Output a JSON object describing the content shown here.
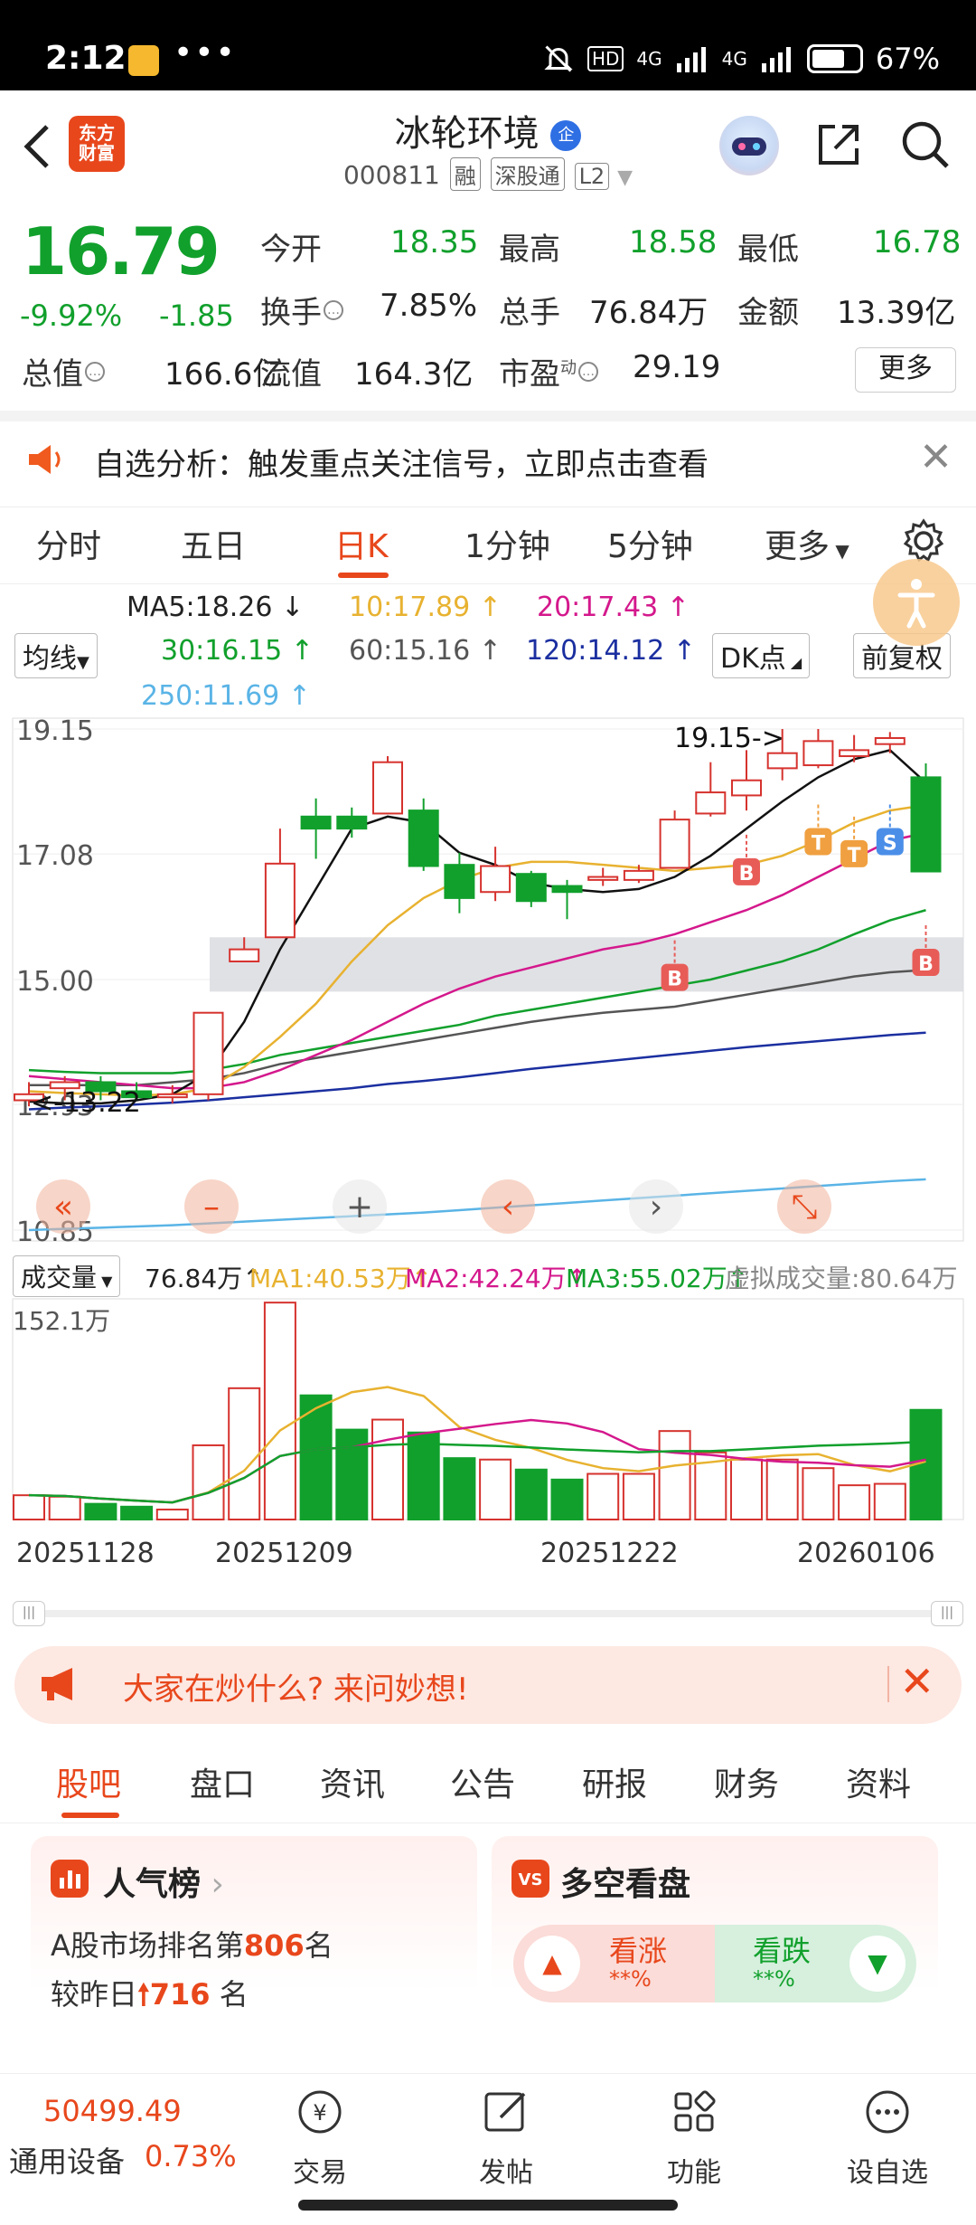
{
  "status_bar": {
    "time": "2:12",
    "dots": "•••",
    "hd": "HD",
    "net1": "4G",
    "net2": "4G",
    "battery": "67%"
  },
  "header": {
    "logo_line1": "东方",
    "logo_line2": "财富",
    "stock_name": "冰轮环境",
    "qi_badge": "企",
    "stock_code": "000811",
    "tags": [
      "融",
      "深股通",
      "L2"
    ]
  },
  "quote": {
    "price": "16.79",
    "change_pct": "-9.92%",
    "change": "-1.85",
    "open_label": "今开",
    "open": "18.35",
    "high_label": "最高",
    "high": "18.58",
    "low_label": "最低",
    "low": "16.78",
    "turnover_label": "换手",
    "turnover": "7.85%",
    "volume_label": "总手",
    "volume": "76.84万",
    "amount_label": "金额",
    "amount": "13.39亿",
    "mcap_label": "总值",
    "mcap": "166.6亿",
    "float_label": "流值",
    "float": "164.3亿",
    "pe_label": "市盈",
    "pe_sup": "动",
    "pe": "29.19",
    "more_label": "更多"
  },
  "alert": {
    "text": "自选分析：触发重点关注信号，立即点击查看"
  },
  "tabs": [
    "分时",
    "五日",
    "日K",
    "1分钟",
    "5分钟",
    "更多"
  ],
  "active_tab": "日K",
  "ma": {
    "selector": "均线",
    "ma5": "MA5:18.26",
    "ma10": "10:17.89",
    "ma20": "20:17.43",
    "ma30": "30:16.15",
    "ma60": "60:15.16",
    "ma120": "120:14.12",
    "ma250": "250:11.69",
    "dk_label": "DK点",
    "adjust_label": "前复权",
    "colors": {
      "ma5": "#111111",
      "ma10": "#e8b230",
      "ma20": "#d4188c",
      "ma30": "#11a02c",
      "ma60": "#555555",
      "ma120": "#1b2fa0",
      "ma250": "#5ab4e6"
    }
  },
  "chart_data": {
    "type": "candlestick",
    "y_ticks": [
      "19.15",
      "17.08",
      "15.00",
      "12.93",
      "10.85"
    ],
    "ylim": [
      10.85,
      19.15
    ],
    "annotations": {
      "high_marker": "19.15->",
      "low_marker": "<-13.22"
    },
    "signal_labels": [
      "B",
      "B",
      "T",
      "T",
      "S",
      "B"
    ],
    "candles": [
      {
        "o": 13.0,
        "c": 13.1,
        "h": 13.3,
        "l": 12.9
      },
      {
        "o": 13.2,
        "c": 13.3,
        "h": 13.4,
        "l": 13.0
      },
      {
        "o": 13.3,
        "c": 13.15,
        "h": 13.4,
        "l": 13.0
      },
      {
        "o": 13.15,
        "c": 13.05,
        "h": 13.3,
        "l": 13.0
      },
      {
        "o": 13.05,
        "c": 13.1,
        "h": 13.25,
        "l": 12.95
      },
      {
        "o": 13.1,
        "c": 14.45,
        "h": 14.45,
        "l": 13.0
      },
      {
        "o": 15.3,
        "c": 15.5,
        "h": 15.7,
        "l": 15.3
      },
      {
        "o": 15.7,
        "c": 16.92,
        "h": 17.5,
        "l": 15.7
      },
      {
        "o": 17.7,
        "c": 17.5,
        "h": 18.0,
        "l": 17.0
      },
      {
        "o": 17.7,
        "c": 17.5,
        "h": 17.85,
        "l": 17.35
      },
      {
        "o": 17.75,
        "c": 18.6,
        "h": 18.7,
        "l": 17.75
      },
      {
        "o": 17.8,
        "c": 16.88,
        "h": 18.0,
        "l": 16.8
      },
      {
        "o": 16.9,
        "c": 16.35,
        "h": 17.1,
        "l": 16.1
      },
      {
        "o": 16.45,
        "c": 16.88,
        "h": 17.2,
        "l": 16.3
      },
      {
        "o": 16.75,
        "c": 16.3,
        "h": 16.8,
        "l": 16.2
      },
      {
        "o": 16.55,
        "c": 16.45,
        "h": 16.65,
        "l": 16.0
      },
      {
        "o": 16.65,
        "c": 16.7,
        "h": 16.85,
        "l": 16.55
      },
      {
        "o": 16.65,
        "c": 16.8,
        "h": 16.9,
        "l": 16.6
      },
      {
        "o": 16.85,
        "c": 17.65,
        "h": 17.8,
        "l": 16.9
      },
      {
        "o": 17.75,
        "c": 18.1,
        "h": 18.6,
        "l": 17.7
      },
      {
        "o": 18.05,
        "c": 18.3,
        "h": 18.8,
        "l": 17.8
      },
      {
        "o": 18.5,
        "c": 18.75,
        "h": 19.15,
        "l": 18.3
      },
      {
        "o": 18.55,
        "c": 18.95,
        "h": 19.15,
        "l": 18.5
      },
      {
        "o": 18.7,
        "c": 18.8,
        "h": 19.05,
        "l": 18.6
      },
      {
        "o": 18.9,
        "c": 19.0,
        "h": 19.1,
        "l": 18.75
      },
      {
        "o": 18.35,
        "c": 16.79,
        "h": 18.58,
        "l": 16.78
      }
    ],
    "ma5": [
      12.98,
      12.95,
      12.95,
      13.0,
      13.1,
      13.45,
      14.3,
      15.5,
      16.5,
      17.5,
      17.7,
      17.6,
      17.1,
      16.9,
      16.6,
      16.5,
      16.45,
      16.5,
      16.7,
      17.05,
      17.5,
      17.95,
      18.35,
      18.65,
      18.8,
      18.26
    ],
    "ma10": [
      13.15,
      13.12,
      13.1,
      13.08,
      13.1,
      13.2,
      13.55,
      14.05,
      14.6,
      15.3,
      15.9,
      16.35,
      16.65,
      16.85,
      16.95,
      16.95,
      16.9,
      16.85,
      16.8,
      16.85,
      16.9,
      17.05,
      17.3,
      17.6,
      17.8,
      17.89
    ],
    "ma20": [
      13.4,
      13.35,
      13.3,
      13.25,
      13.2,
      13.2,
      13.3,
      13.5,
      13.75,
      14.0,
      14.3,
      14.6,
      14.85,
      15.05,
      15.2,
      15.35,
      15.5,
      15.6,
      15.75,
      15.95,
      16.15,
      16.4,
      16.7,
      17.0,
      17.3,
      17.43
    ],
    "ma30": [
      13.5,
      13.47,
      13.45,
      13.45,
      13.45,
      13.5,
      13.6,
      13.75,
      13.85,
      13.95,
      14.05,
      14.15,
      14.25,
      14.4,
      14.5,
      14.6,
      14.7,
      14.8,
      14.9,
      15.0,
      15.15,
      15.3,
      15.5,
      15.75,
      15.98,
      16.15
    ],
    "ma60": [
      13.25,
      13.25,
      13.25,
      13.25,
      13.3,
      13.35,
      13.45,
      13.6,
      13.7,
      13.8,
      13.9,
      14.0,
      14.1,
      14.2,
      14.3,
      14.38,
      14.45,
      14.5,
      14.55,
      14.65,
      14.75,
      14.85,
      14.95,
      15.05,
      15.12,
      15.16
    ],
    "ma120": [
      12.85,
      12.88,
      12.9,
      12.93,
      12.96,
      13.0,
      13.05,
      13.1,
      13.15,
      13.2,
      13.27,
      13.32,
      13.38,
      13.45,
      13.52,
      13.58,
      13.64,
      13.7,
      13.76,
      13.82,
      13.88,
      13.93,
      13.98,
      14.03,
      14.08,
      14.12
    ],
    "ma250": [
      10.85,
      10.87,
      10.89,
      10.91,
      10.93,
      10.96,
      10.99,
      11.02,
      11.05,
      11.08,
      11.11,
      11.14,
      11.18,
      11.22,
      11.26,
      11.3,
      11.34,
      11.38,
      11.42,
      11.46,
      11.5,
      11.54,
      11.58,
      11.62,
      11.66,
      11.69
    ],
    "volume_label": "成交量",
    "volume_total": "76.84万",
    "vol_ma1": "MA1:40.53万",
    "vol_ma2": "MA2:42.24万",
    "vol_ma3": "MA3:55.02万",
    "virtual_volume": "虚拟成交量:80.64万",
    "vol_y_max": "152.1万",
    "volumes": [
      17,
      16,
      11,
      9,
      7,
      52,
      92,
      152,
      87,
      63,
      70,
      61,
      43,
      42,
      35,
      28,
      32,
      32,
      62,
      47,
      42,
      42,
      36,
      24,
      25,
      76.84
    ],
    "dates": [
      "20251128",
      "20251209",
      "20251222",
      "20260106"
    ]
  },
  "ask_bar": {
    "text": "大家在炒什么? 来问妙想!"
  },
  "bottom_tabs": [
    "股吧",
    "盘口",
    "资讯",
    "公告",
    "研报",
    "财务",
    "资料"
  ],
  "popularity": {
    "title": "人气榜",
    "rank_prefix": "A股市场排名第",
    "rank": "806",
    "rank_suffix": "名",
    "change_prefix": "较昨日",
    "change": "716",
    "change_suffix": "名"
  },
  "long_short": {
    "title": "多空看盘",
    "up_label": "看涨",
    "up_pct": "**%",
    "down_label": "看跌",
    "down_pct": "**%"
  },
  "nav": {
    "index_value": "50499.49",
    "index_name": "通用设备",
    "index_pct": "0.73%",
    "items": [
      "交易",
      "发帖",
      "功能",
      "设自选"
    ]
  }
}
